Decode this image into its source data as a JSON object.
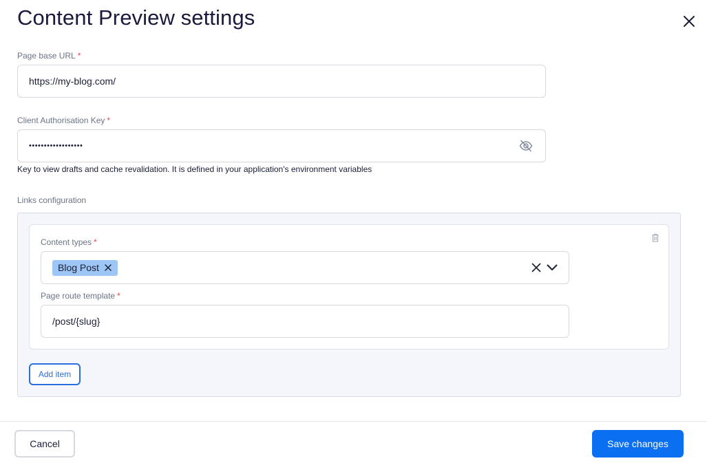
{
  "dialog": {
    "title": "Content Preview settings"
  },
  "base_url": {
    "label": "Page base URL",
    "required_mark": "*",
    "value": "https://my-blog.com/"
  },
  "auth_key": {
    "label": "Client Authorisation Key",
    "required_mark": "*",
    "value": "••••••••••••••••••",
    "help_text": "Key to view drafts and cache revalidation. It is defined in your application's environment variables",
    "visibility_icon": "eye-off-icon"
  },
  "links": {
    "label": "Links configuration",
    "items": [
      {
        "content_types_label": "Content types",
        "content_types_required": "*",
        "selected_types": [
          "Blog Post"
        ],
        "route_template_label": "Page route template",
        "route_template_required": "*",
        "route_template_value": "/post/{slug}"
      }
    ],
    "add_item_label": "Add item"
  },
  "footer": {
    "cancel_label": "Cancel",
    "save_label": "Save changes"
  },
  "colors": {
    "primary": "#0a6ff0",
    "chip": "#9ec6f4",
    "required": "#e5484d",
    "panel_bg": "#f4f6fb"
  }
}
